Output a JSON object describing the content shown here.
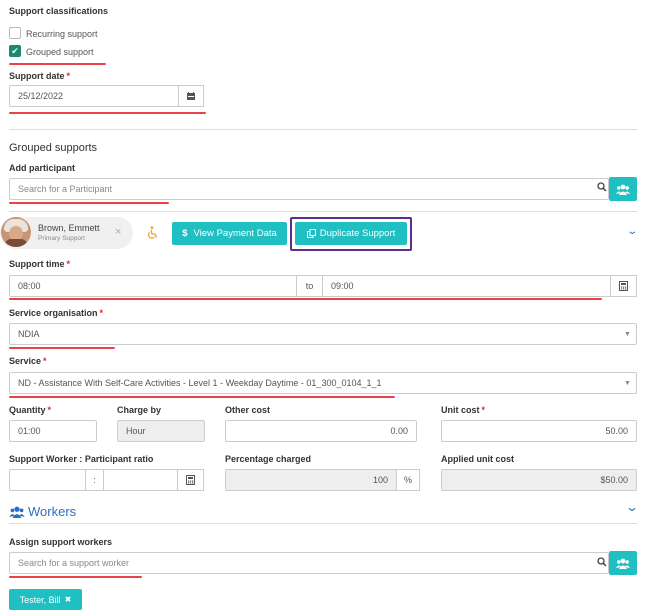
{
  "classifications": {
    "title": "Support classifications",
    "recurring_label": "Recurring support",
    "grouped_label": "Grouped support",
    "grouped_checked": true
  },
  "support_date": {
    "label": "Support date",
    "required": "*",
    "value": "25/12/2022"
  },
  "grouped": {
    "title": "Grouped supports",
    "add_participant_label": "Add participant",
    "participant_placeholder": "Search for a Participant"
  },
  "participant": {
    "name": "Brown, Emmett",
    "role": "Primary Support",
    "remove_glyph": "×",
    "view_payment_label": "View Payment Data",
    "duplicate_label": "Duplicate Support"
  },
  "support_time": {
    "label": "Support time",
    "from": "08:00",
    "to_label": "to",
    "to": "09:00"
  },
  "service_org": {
    "label": "Service organisation",
    "value": "NDIA"
  },
  "service": {
    "label": "Service",
    "value": "ND - Assistance With Self-Care Activities - Level 1 - Weekday Daytime - 01_300_0104_1_1"
  },
  "quantity": {
    "label": "Quantity",
    "value": "01:00"
  },
  "charge_by": {
    "label": "Charge by",
    "value": "Hour"
  },
  "other_cost": {
    "label": "Other cost",
    "value": "0.00"
  },
  "unit_cost": {
    "label": "Unit cost",
    "value": "50.00"
  },
  "ratio": {
    "label": "Support Worker : Participant ratio",
    "separator": ":"
  },
  "percentage": {
    "label": "Percentage charged",
    "value": "100",
    "unit": "%"
  },
  "applied": {
    "label": "Applied unit cost",
    "value": "$50.00"
  },
  "workers": {
    "title": "Workers",
    "assign_label": "Assign support workers",
    "placeholder": "Search for a support worker",
    "chip": "Tester, Bill",
    "chip_remove": "✖"
  },
  "colors": {
    "accent": "#1fbfc2",
    "required": "#d9282f",
    "underline": "#e8434b",
    "highlight": "#5c2d91",
    "check": "#1b8a6e"
  }
}
